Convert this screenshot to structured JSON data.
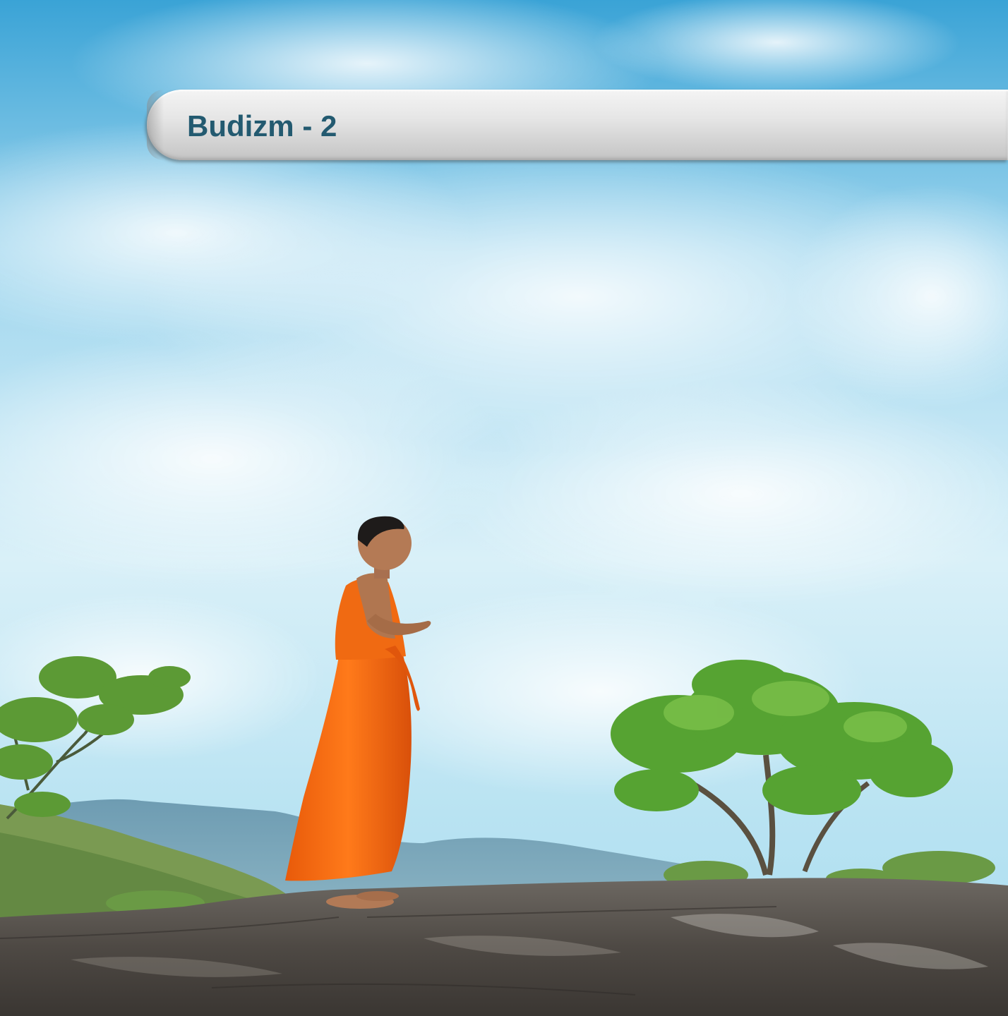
{
  "slide": {
    "title": "Budizm - 2"
  },
  "background_photo": {
    "subject": "monk-in-orange-robe-on-rock",
    "colors": {
      "sky": "#7fc7e6",
      "cloud": "#ffffff",
      "robe": "#f06a12",
      "rock": "#5b5550",
      "foliage": "#4f9a2a",
      "hills": "#6f9ab0"
    }
  },
  "colors": {
    "title_text": "#235a70",
    "title_bar": "#dcdcdc"
  }
}
